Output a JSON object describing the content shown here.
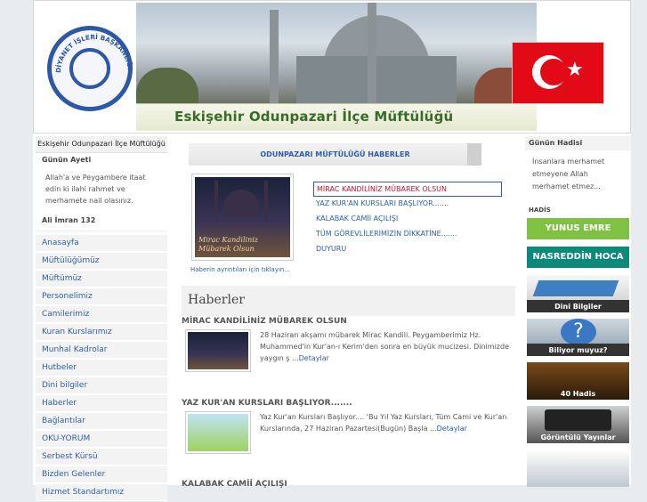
{
  "header": {
    "title": "Eskişehir Odunpazari İlçe Müftülüğü",
    "logo_text": "DİYANET İŞLERİ BAŞKANLIĞI"
  },
  "left": {
    "site_name": "Eskişehir Odunpazari İlçe Müftülüğü",
    "ayet_heading": "Günün Ayeti",
    "ayet_text": "Allah'a ve Peygambere itaat edin ki ilahi rahmet ve merhamete nail olasınız.",
    "ayet_ref": "Ali İmran 132",
    "menu": [
      "Anasayfa",
      "Müftülüğümüz",
      "Müftümüz",
      "Personelimiz",
      "Camilerimiz",
      "Kuran Kurslarımız",
      "Munhal Kadrolar",
      "Hutbeler",
      "Dini bilgiler",
      "Haberler",
      "Bağlantılar",
      "OKU-YORUM",
      "Serbest Kürsü",
      "Bizden Gelenler",
      "Hizmet Standartımız"
    ]
  },
  "center": {
    "news_header": "ODUNPAZARI MÜFTÜLÜĞÜ HABERLER",
    "slider_caption": "Mirac Kandiliniz Mübarek Olsun",
    "slider_link": "Haberin ayrıntıları için tıklayın...",
    "slider_items": [
      "MİRAC KANDİLİNİZ MÜBAREK OLSUN",
      "YAZ KUR'AN KURSLARI BAŞLIYOR.......",
      "KALABAK CAMİİ AÇILIŞI",
      "TÜM GÖREVLİLERİMİZİN DİKKATİNE.......",
      "DUYURU"
    ],
    "section_title": "Haberler",
    "articles": [
      {
        "title": "MİRAC KANDİLİNİZ MÜBAREK OLSUN",
        "text": "28 Haziran akşamı mübarek Mirac Kandili. Peygamberimiz Hz. Muhammed'in Kur'an-ı Kerim'den sonra en büyük mucizesi. Dinimizde yaygın ş ...",
        "more": "Detaylar"
      },
      {
        "title": "YAZ KUR'AN KURSLARI BAŞLIYOR.......",
        "text": "Yaz Kur'an Kursları Başlıyor.... 'Bu Yıl Yaz Kursları, Tüm Cami ve Kur'an Kurslarında, 27 Haziran Pazartesi(Bugün) Başla ...",
        "more": "Detaylar"
      },
      {
        "title": "KALABAK CAMİİ AÇILIŞI"
      }
    ]
  },
  "right": {
    "hadis_heading": "Günün Hadisi",
    "hadis_text": "İnsanlara merhamet etmeyene Allah merhamet etmez...",
    "hadis_sub": "HADİS",
    "banners": [
      "YUNUS EMRE",
      "NASREDDİN HOCA"
    ],
    "picture_banners": [
      "Dini Bilgiler",
      "Biliyor muyuz?",
      "40 Hadis",
      "Görüntülü Yayınlar"
    ]
  }
}
